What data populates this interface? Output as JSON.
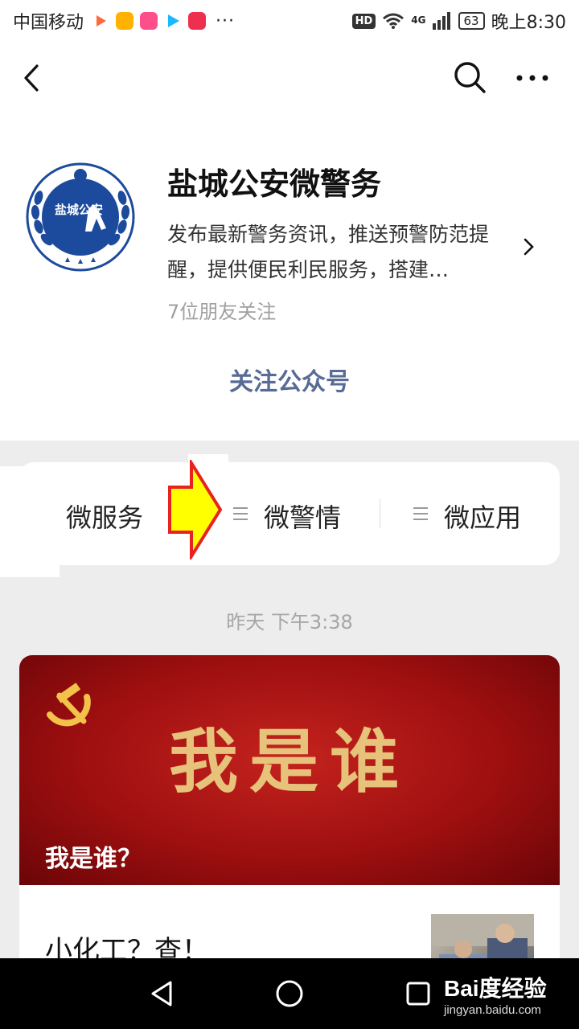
{
  "status_bar": {
    "carrier": "中国移动",
    "time": "晚上8:30",
    "battery": "63",
    "hd": "HD",
    "network": "4G",
    "more": "···"
  },
  "account": {
    "name": "盐城公安微警务",
    "description": "发布最新警务资讯，推送预警防范提醒，提供便民利民服务，搭建…",
    "friends_following": "7位朋友关注",
    "follow_button": "关注公众号",
    "logo_text": "盐城公安"
  },
  "menu": {
    "items": [
      {
        "label": "微服务"
      },
      {
        "label": "微警情"
      },
      {
        "label": "微应用"
      }
    ]
  },
  "feed": {
    "timestamp": "昨天 下午3:38",
    "cover_title": "我是谁？",
    "cover_art_text": "我是谁",
    "second_title": "小化工？查！"
  },
  "watermark": {
    "main": "Bai度经验",
    "sub": "jingyan.baidu.com"
  },
  "colors": {
    "link": "#576b95",
    "cover_red": "#b01818",
    "arrow_fill": "#ffff00",
    "arrow_stroke": "#e8231f"
  }
}
